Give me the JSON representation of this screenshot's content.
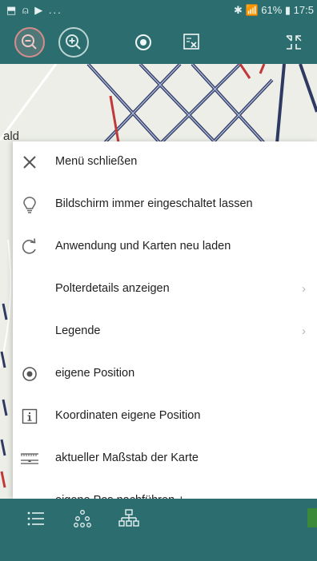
{
  "statusbar": {
    "left_icons": "⬒ ⍝ ▶ ...",
    "right_text": "✱ 📶 61% ▮ 17:5"
  },
  "toolbar": {
    "buttons": [
      "zoom-out-icon",
      "zoom-in-icon",
      "my-location-icon",
      "coordinates-close-icon",
      "exit-fullscreen-icon"
    ]
  },
  "map_labels": {
    "edge_text": "ald"
  },
  "menu": {
    "items": [
      {
        "label": "Menü schließen",
        "icon": "close-icon",
        "has_submenu": false
      },
      {
        "label": "Bildschirm immer eingeschaltet lassen",
        "icon": "lightbulb-icon",
        "has_submenu": false
      },
      {
        "label": "Anwendung und Karten neu laden",
        "icon": "reload-icon",
        "has_submenu": false
      },
      {
        "label": "Polterdetails anzeigen",
        "icon": "",
        "has_submenu": true
      },
      {
        "label": "Legende",
        "icon": "",
        "has_submenu": true
      },
      {
        "label": "eigene Position",
        "icon": "target-icon",
        "has_submenu": false
      },
      {
        "label": "Koordinaten eigene Position",
        "icon": "info-box-icon",
        "has_submenu": false
      },
      {
        "label": "aktueller Maßstab der Karte",
        "icon": "scale-ruler-icon",
        "has_submenu": false
      },
      {
        "label": "eigene Pos nachführen + -",
        "icon": "",
        "has_submenu": true
      }
    ],
    "chevron": "›"
  },
  "bottombar": {
    "icons": [
      "menu-list-icon",
      "tree-network-icon",
      "hierarchy-icon"
    ]
  },
  "colors": {
    "bar": "#2c6e70",
    "menu_bg": "#ffffff",
    "zoom_out_ring": "#d78c8c"
  }
}
